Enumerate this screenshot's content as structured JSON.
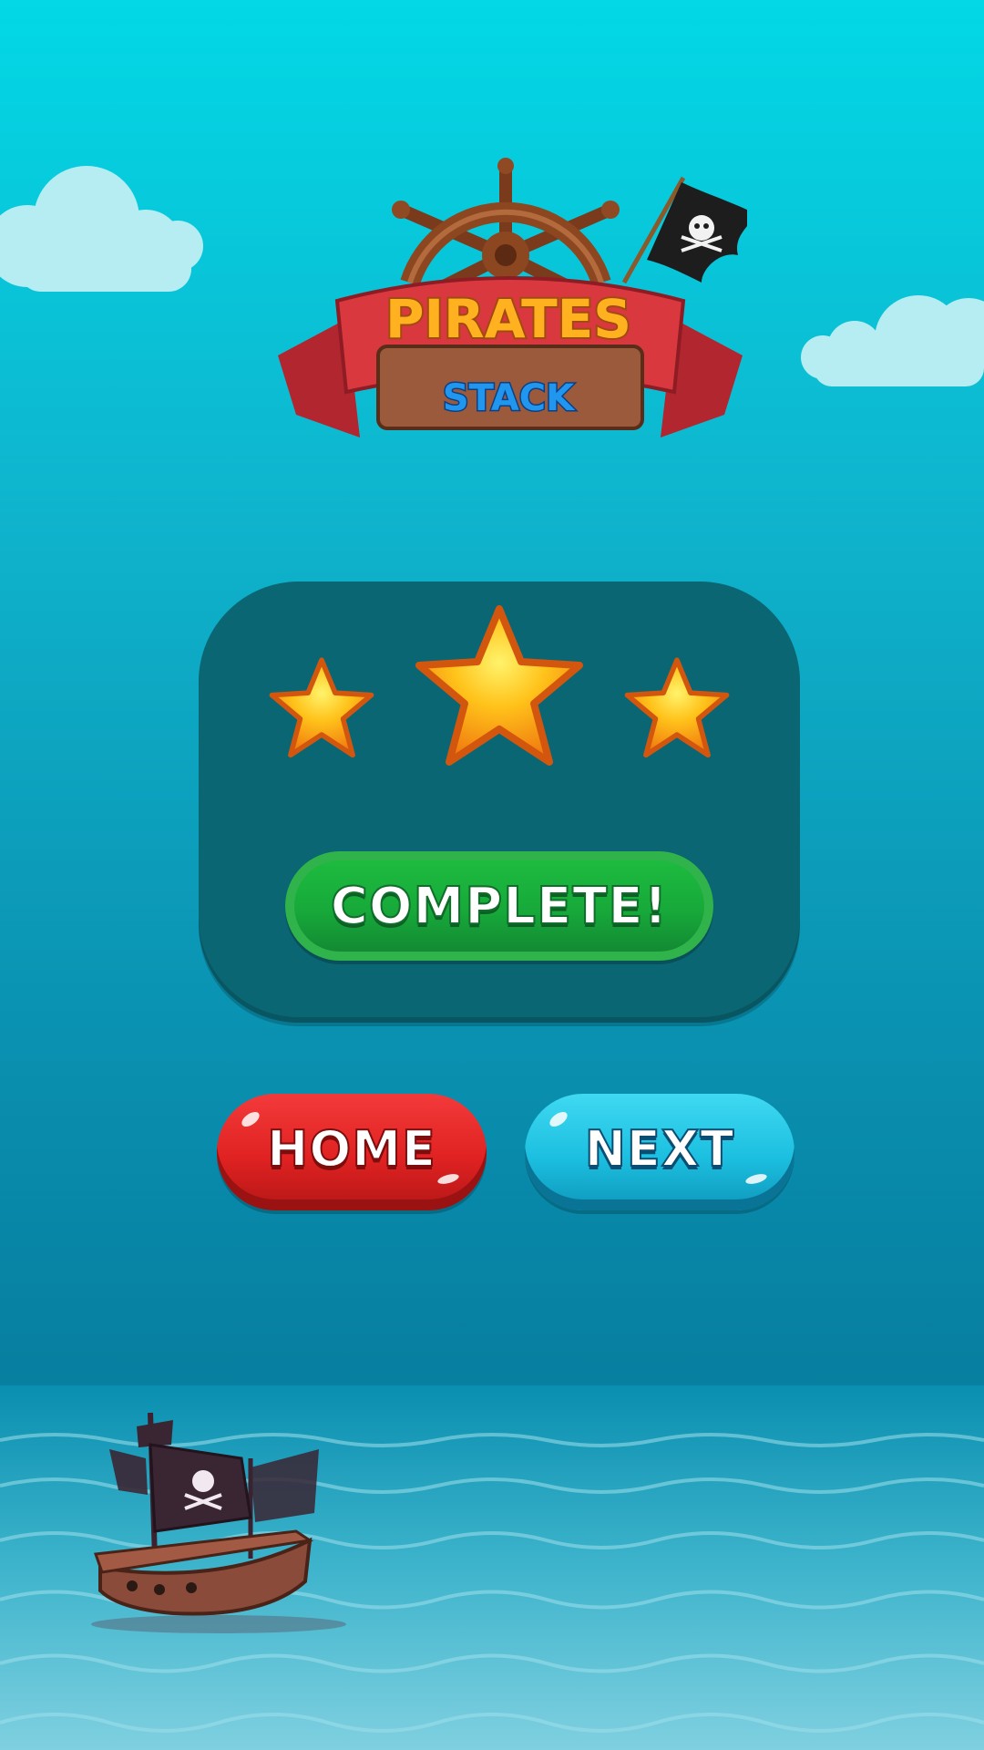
{
  "game": {
    "logo": {
      "title": "PIRATES",
      "subtitle": "STACK"
    },
    "result": {
      "stars_earned": 3,
      "stars_total": 3,
      "status_label": "COMPLETE!"
    },
    "buttons": {
      "home_label": "HOME",
      "next_label": "NEXT"
    },
    "icons": {
      "logo_emblem": "ship-wheel-icon",
      "flag": "jolly-roger-flag-icon",
      "star": "star-icon",
      "ship": "pirate-ship-icon"
    }
  },
  "colors": {
    "sky_top": "#02d8e6",
    "panel": "#0a6672",
    "star_gold": "#ffc21a",
    "complete_green": "#1dbb3f",
    "home_red": "#e02222",
    "next_cyan": "#1cbfe0",
    "logo_red": "#d9383f",
    "logo_orange": "#ff9d1a",
    "logo_blue": "#1f8de0"
  }
}
